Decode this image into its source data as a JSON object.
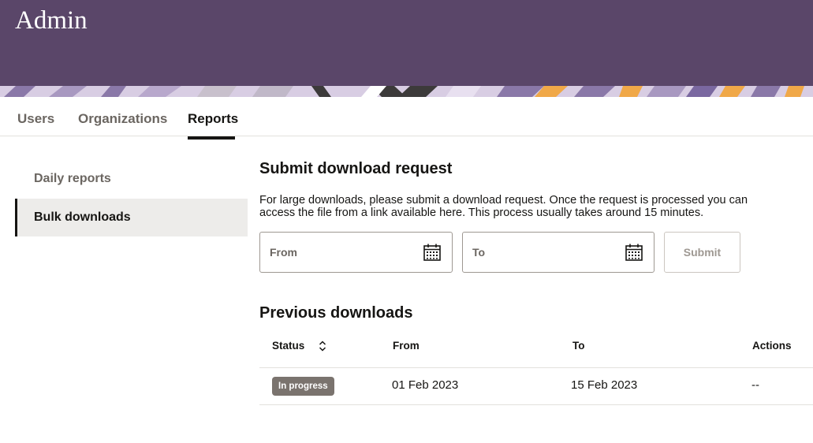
{
  "header": {
    "title": "Admin"
  },
  "tabs": [
    {
      "label": "Users",
      "active": false
    },
    {
      "label": "Organizations",
      "active": false
    },
    {
      "label": "Reports",
      "active": true
    }
  ],
  "sidebar": {
    "items": [
      {
        "label": "Daily reports",
        "active": false
      },
      {
        "label": "Bulk downloads",
        "active": true
      }
    ]
  },
  "request": {
    "title": "Submit download request",
    "description": "For large downloads, please submit a download request. Once the request is processed you can access the file from a link available here. This process usually takes around 15 minutes.",
    "from_placeholder": "From",
    "to_placeholder": "To",
    "submit_label": "Submit"
  },
  "previous": {
    "title": "Previous downloads",
    "columns": [
      "Status",
      "From",
      "To",
      "Actions"
    ],
    "rows": [
      {
        "status": "In progress",
        "from": "01 Feb 2023",
        "to": "15 Feb 2023",
        "actions": "--"
      }
    ]
  },
  "colors": {
    "header_bg": "#5a4669",
    "badge_bg": "#7a736e",
    "accent_orange": "#f0a848",
    "accent_purple": "#8a78a8"
  }
}
